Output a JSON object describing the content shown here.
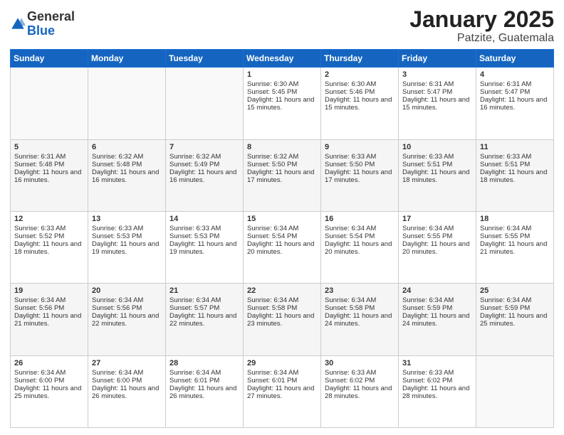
{
  "header": {
    "logo_general": "General",
    "logo_blue": "Blue",
    "title": "January 2025",
    "subtitle": "Patzite, Guatemala"
  },
  "days_of_week": [
    "Sunday",
    "Monday",
    "Tuesday",
    "Wednesday",
    "Thursday",
    "Friday",
    "Saturday"
  ],
  "weeks": [
    [
      {
        "day": "",
        "content": ""
      },
      {
        "day": "",
        "content": ""
      },
      {
        "day": "",
        "content": ""
      },
      {
        "day": "1",
        "content": "Sunrise: 6:30 AM\nSunset: 5:45 PM\nDaylight: 11 hours and 15 minutes."
      },
      {
        "day": "2",
        "content": "Sunrise: 6:30 AM\nSunset: 5:46 PM\nDaylight: 11 hours and 15 minutes."
      },
      {
        "day": "3",
        "content": "Sunrise: 6:31 AM\nSunset: 5:47 PM\nDaylight: 11 hours and 15 minutes."
      },
      {
        "day": "4",
        "content": "Sunrise: 6:31 AM\nSunset: 5:47 PM\nDaylight: 11 hours and 16 minutes."
      }
    ],
    [
      {
        "day": "5",
        "content": "Sunrise: 6:31 AM\nSunset: 5:48 PM\nDaylight: 11 hours and 16 minutes."
      },
      {
        "day": "6",
        "content": "Sunrise: 6:32 AM\nSunset: 5:48 PM\nDaylight: 11 hours and 16 minutes."
      },
      {
        "day": "7",
        "content": "Sunrise: 6:32 AM\nSunset: 5:49 PM\nDaylight: 11 hours and 16 minutes."
      },
      {
        "day": "8",
        "content": "Sunrise: 6:32 AM\nSunset: 5:50 PM\nDaylight: 11 hours and 17 minutes."
      },
      {
        "day": "9",
        "content": "Sunrise: 6:33 AM\nSunset: 5:50 PM\nDaylight: 11 hours and 17 minutes."
      },
      {
        "day": "10",
        "content": "Sunrise: 6:33 AM\nSunset: 5:51 PM\nDaylight: 11 hours and 18 minutes."
      },
      {
        "day": "11",
        "content": "Sunrise: 6:33 AM\nSunset: 5:51 PM\nDaylight: 11 hours and 18 minutes."
      }
    ],
    [
      {
        "day": "12",
        "content": "Sunrise: 6:33 AM\nSunset: 5:52 PM\nDaylight: 11 hours and 18 minutes."
      },
      {
        "day": "13",
        "content": "Sunrise: 6:33 AM\nSunset: 5:53 PM\nDaylight: 11 hours and 19 minutes."
      },
      {
        "day": "14",
        "content": "Sunrise: 6:33 AM\nSunset: 5:53 PM\nDaylight: 11 hours and 19 minutes."
      },
      {
        "day": "15",
        "content": "Sunrise: 6:34 AM\nSunset: 5:54 PM\nDaylight: 11 hours and 20 minutes."
      },
      {
        "day": "16",
        "content": "Sunrise: 6:34 AM\nSunset: 5:54 PM\nDaylight: 11 hours and 20 minutes."
      },
      {
        "day": "17",
        "content": "Sunrise: 6:34 AM\nSunset: 5:55 PM\nDaylight: 11 hours and 20 minutes."
      },
      {
        "day": "18",
        "content": "Sunrise: 6:34 AM\nSunset: 5:55 PM\nDaylight: 11 hours and 21 minutes."
      }
    ],
    [
      {
        "day": "19",
        "content": "Sunrise: 6:34 AM\nSunset: 5:56 PM\nDaylight: 11 hours and 21 minutes."
      },
      {
        "day": "20",
        "content": "Sunrise: 6:34 AM\nSunset: 5:56 PM\nDaylight: 11 hours and 22 minutes."
      },
      {
        "day": "21",
        "content": "Sunrise: 6:34 AM\nSunset: 5:57 PM\nDaylight: 11 hours and 22 minutes."
      },
      {
        "day": "22",
        "content": "Sunrise: 6:34 AM\nSunset: 5:58 PM\nDaylight: 11 hours and 23 minutes."
      },
      {
        "day": "23",
        "content": "Sunrise: 6:34 AM\nSunset: 5:58 PM\nDaylight: 11 hours and 24 minutes."
      },
      {
        "day": "24",
        "content": "Sunrise: 6:34 AM\nSunset: 5:59 PM\nDaylight: 11 hours and 24 minutes."
      },
      {
        "day": "25",
        "content": "Sunrise: 6:34 AM\nSunset: 5:59 PM\nDaylight: 11 hours and 25 minutes."
      }
    ],
    [
      {
        "day": "26",
        "content": "Sunrise: 6:34 AM\nSunset: 6:00 PM\nDaylight: 11 hours and 25 minutes."
      },
      {
        "day": "27",
        "content": "Sunrise: 6:34 AM\nSunset: 6:00 PM\nDaylight: 11 hours and 26 minutes."
      },
      {
        "day": "28",
        "content": "Sunrise: 6:34 AM\nSunset: 6:01 PM\nDaylight: 11 hours and 26 minutes."
      },
      {
        "day": "29",
        "content": "Sunrise: 6:34 AM\nSunset: 6:01 PM\nDaylight: 11 hours and 27 minutes."
      },
      {
        "day": "30",
        "content": "Sunrise: 6:33 AM\nSunset: 6:02 PM\nDaylight: 11 hours and 28 minutes."
      },
      {
        "day": "31",
        "content": "Sunrise: 6:33 AM\nSunset: 6:02 PM\nDaylight: 11 hours and 28 minutes."
      },
      {
        "day": "",
        "content": ""
      }
    ]
  ]
}
